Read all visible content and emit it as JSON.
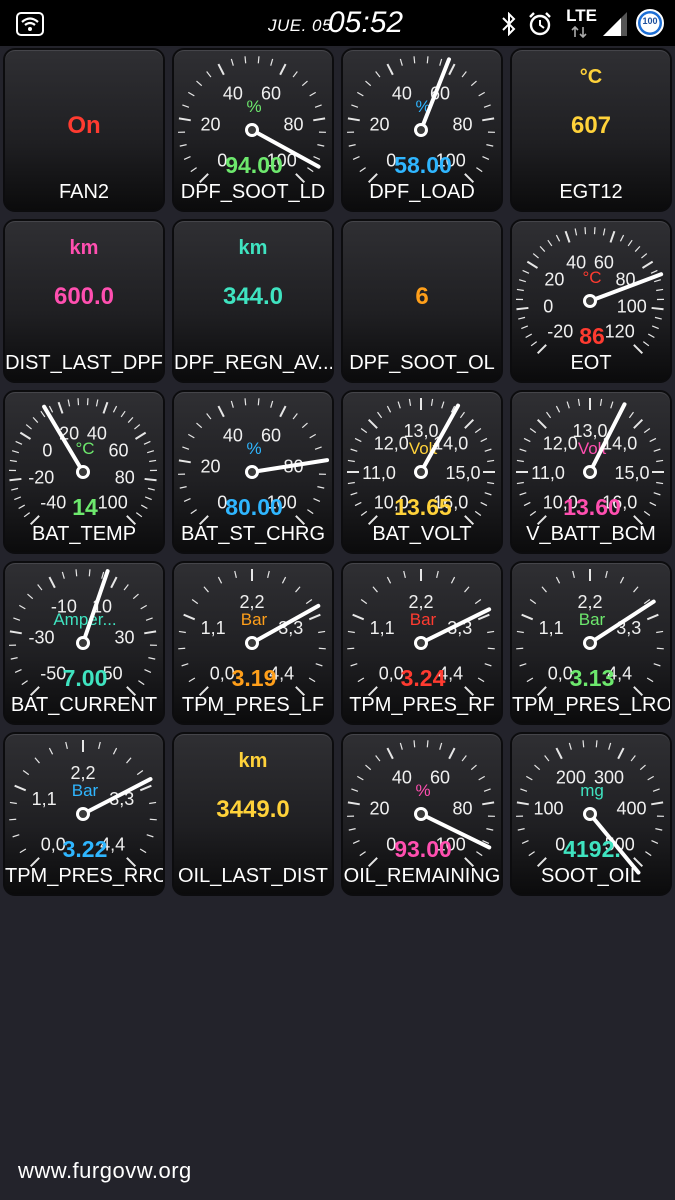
{
  "status_bar": {
    "date": "JUE. 05",
    "time": "05:52",
    "network": "LTE",
    "battery": "100"
  },
  "tiles": [
    {
      "label": "FAN2",
      "type": "text",
      "value": "On",
      "value_color": "#ff3b30"
    },
    {
      "label": "DPF_SOOT_LD",
      "type": "gauge",
      "unit": "%",
      "unit_color": "#6de86d",
      "value": "94.00",
      "value_color": "#6de86d",
      "ticks": [
        "0",
        "20",
        "40",
        "60",
        "80",
        "100"
      ],
      "needle": 0.94
    },
    {
      "label": "DPF_LOAD",
      "type": "gauge",
      "unit": "%",
      "unit_color": "#2fb6ff",
      "value": "58.00",
      "value_color": "#2fb6ff",
      "ticks": [
        "0",
        "20",
        "40",
        "60",
        "80",
        "100"
      ],
      "needle": 0.58
    },
    {
      "label": "EGT12",
      "type": "text",
      "unit": "°C",
      "unit_color": "#ffd23a",
      "value": "607",
      "value_color": "#ffd23a"
    },
    {
      "label": "DIST_LAST_DPF",
      "type": "text",
      "unit": "km",
      "unit_color": "#ff4fb0",
      "value": "600.0",
      "value_color": "#ff4fb0"
    },
    {
      "label": "DPF_REGN_AV...",
      "type": "text",
      "unit": "km",
      "unit_color": "#3fe3c0",
      "value": "344.0",
      "value_color": "#3fe3c0"
    },
    {
      "label": "DPF_SOOT_OL",
      "type": "text",
      "value": "6",
      "value_color": "#ff9f1a"
    },
    {
      "label": "EOT",
      "type": "gauge",
      "unit": "°C",
      "unit_color": "#ff3b30",
      "value": "86",
      "value_color": "#ff3b30",
      "ticks": [
        "-20",
        "0",
        "20",
        "40",
        "60",
        "80",
        "100",
        "120"
      ],
      "needle": 0.757
    },
    {
      "label": "BAT_TEMP",
      "type": "gauge",
      "unit": "°C",
      "unit_color": "#6de86d",
      "value": "14",
      "value_color": "#6de86d",
      "ticks": [
        "-40",
        "-20",
        "0",
        "20",
        "40",
        "60",
        "80",
        "100"
      ],
      "needle": 0.386
    },
    {
      "label": "BAT_ST_CHRG",
      "type": "gauge",
      "unit": "%",
      "unit_color": "#2fb6ff",
      "value": "80.00",
      "value_color": "#2fb6ff",
      "ticks": [
        "0",
        "20",
        "40",
        "60",
        "80",
        "100"
      ],
      "needle": 0.8
    },
    {
      "label": "BAT_VOLT",
      "type": "gauge",
      "unit": "Volt",
      "unit_color": "#ffd23a",
      "value": "13.65",
      "value_color": "#ffd23a",
      "ticks": [
        "10,0",
        "11,0",
        "12,0",
        "13,0",
        "14,0",
        "15,0",
        "16,0"
      ],
      "needle": 0.608
    },
    {
      "label": "V_BATT_BCM",
      "type": "gauge",
      "unit": "Volt",
      "unit_color": "#ff4fb0",
      "value": "13.60",
      "value_color": "#ff4fb0",
      "ticks": [
        "10,0",
        "11,0",
        "12,0",
        "13,0",
        "14,0",
        "15,0",
        "16,0"
      ],
      "needle": 0.6
    },
    {
      "label": "BAT_CURRENT",
      "type": "gauge",
      "unit": "Amper...",
      "unit_color": "#3fe3c0",
      "value": "7.00",
      "value_color": "#3fe3c0",
      "ticks": [
        "-50",
        "-30",
        "-10",
        "10",
        "30",
        "50"
      ],
      "needle": 0.57
    },
    {
      "label": "TPM_PRES_LF",
      "type": "gauge",
      "unit": "Bar",
      "unit_color": "#ff9f1a",
      "value": "3.19",
      "value_color": "#ff9f1a",
      "ticks": [
        "0,0",
        "1,1",
        "2,2",
        "3,3",
        "4,4"
      ],
      "needle": 0.725
    },
    {
      "label": "TPM_PRES_RF",
      "type": "gauge",
      "unit": "Bar",
      "unit_color": "#ff3b30",
      "value": "3.24",
      "value_color": "#ff3b30",
      "ticks": [
        "0,0",
        "1,1",
        "2,2",
        "3,3",
        "4,4"
      ],
      "needle": 0.736
    },
    {
      "label": "TPM_PRES_LRO",
      "type": "gauge",
      "unit": "Bar",
      "unit_color": "#6de86d",
      "value": "3.13",
      "value_color": "#6de86d",
      "ticks": [
        "0,0",
        "1,1",
        "2,2",
        "3,3",
        "4,4"
      ],
      "needle": 0.711
    },
    {
      "label": "TPM_PRES_RRO",
      "type": "gauge",
      "unit": "Bar",
      "unit_color": "#2fb6ff",
      "value": "3.22",
      "value_color": "#2fb6ff",
      "ticks": [
        "0,0",
        "1,1",
        "2,2",
        "3,3",
        "4,4"
      ],
      "needle": 0.732
    },
    {
      "label": "OIL_LAST_DIST",
      "type": "text",
      "unit": "km",
      "unit_color": "#ffd23a",
      "value": "3449.0",
      "value_color": "#ffd23a"
    },
    {
      "label": "OIL_REMAINING",
      "type": "gauge",
      "unit": "%",
      "unit_color": "#ff4fb0",
      "value": "93.00",
      "value_color": "#ff4fb0",
      "ticks": [
        "0",
        "20",
        "40",
        "60",
        "80",
        "100"
      ],
      "needle": 0.93
    },
    {
      "label": "SOOT_OIL",
      "type": "gauge",
      "unit": "mg",
      "unit_color": "#3fe3c0",
      "value": "4192.",
      "value_color": "#3fe3c0",
      "ticks": [
        "0",
        "100",
        "200",
        "300",
        "400",
        "500"
      ],
      "needle": 1.02
    }
  ],
  "footer": {
    "text": "www.furgovw.org"
  }
}
